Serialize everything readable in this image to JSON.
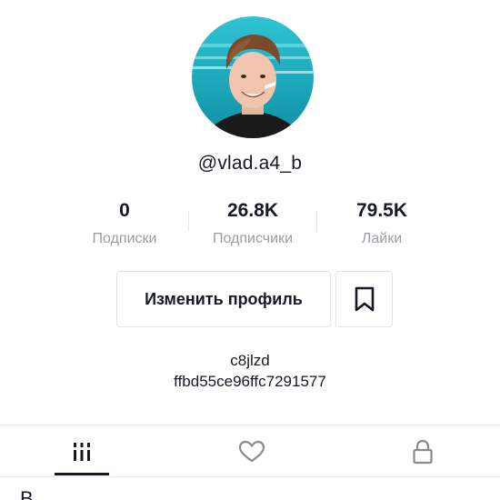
{
  "profile": {
    "username": "@vlad.a4_b"
  },
  "stats": [
    {
      "value": "0",
      "label": "Подписки"
    },
    {
      "value": "26.8K",
      "label": "Подписчики"
    },
    {
      "value": "79.5K",
      "label": "Лайки"
    }
  ],
  "actions": {
    "edit_profile_label": "Изменить профиль",
    "bookmark_icon": "bookmark-icon"
  },
  "bio": {
    "line1": "c8jlzd",
    "line2": "ffbd55ce96ffc7291577"
  },
  "tabs": [
    {
      "icon": "videos-grid-icon",
      "active": true
    },
    {
      "icon": "heart-icon",
      "active": false
    },
    {
      "icon": "lock-icon",
      "active": false
    }
  ],
  "footer": {
    "partial_text": "В"
  },
  "colors": {
    "text": "#161823",
    "secondary": "#9b9ca1",
    "border": "#e3e3e5",
    "avatar_bg": "#1fb5c9"
  }
}
